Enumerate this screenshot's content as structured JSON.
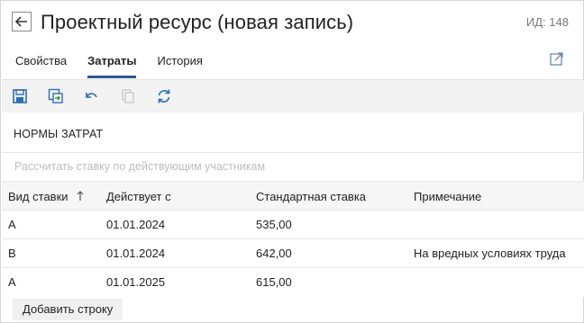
{
  "header": {
    "title": "Проектный ресурс (новая запись)",
    "id_label": "ИД:",
    "id_value": "148"
  },
  "tabs": [
    {
      "label": "Свойства",
      "active": false
    },
    {
      "label": "Затраты",
      "active": true
    },
    {
      "label": "История",
      "active": false
    }
  ],
  "toolbar": {
    "icons": [
      "save-icon",
      "save-and-close-icon",
      "undo-icon",
      "copy-icon",
      "refresh-icon"
    ],
    "accent_color": "#2a6db5"
  },
  "section": {
    "title": "НОРМЫ ЗАТРАТ",
    "calc_link": "Рассчитать ставку по действующим участникам"
  },
  "table": {
    "columns": [
      "Вид ставки",
      "Действует с",
      "Стандартная ставка",
      "Примечание"
    ],
    "rows": [
      {
        "type": "A",
        "date": "01.01.2024",
        "rate": "535,00",
        "note": ""
      },
      {
        "type": "B",
        "date": "01.01.2024",
        "rate": "642,00",
        "note": "На вредных условиях труда"
      },
      {
        "type": "A",
        "date": "01.01.2025",
        "rate": "615,00",
        "note": ""
      }
    ]
  },
  "add_row_label": "Добавить строку"
}
